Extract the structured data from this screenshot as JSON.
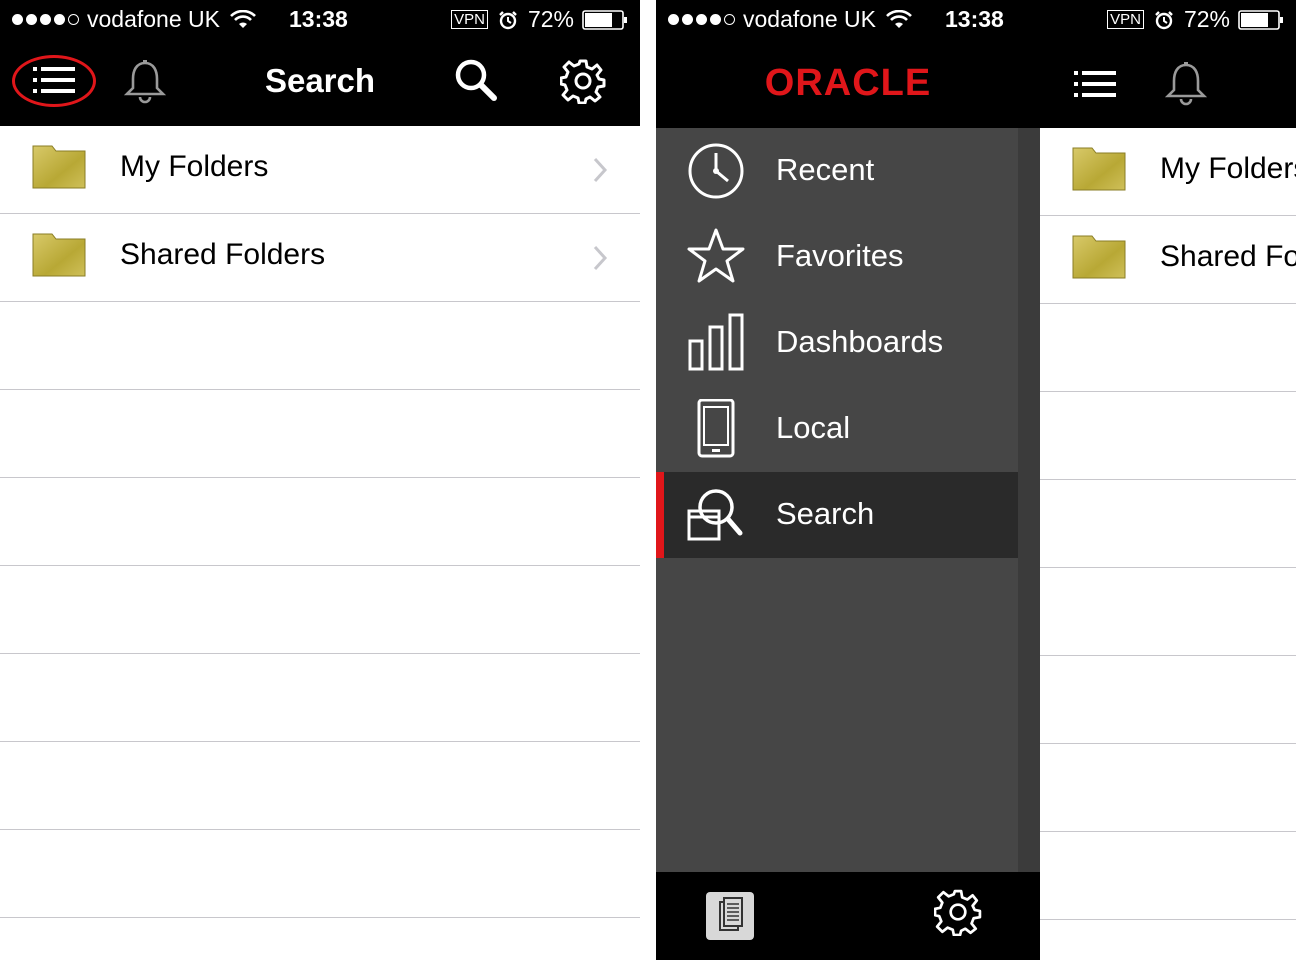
{
  "status_bar": {
    "carrier": "vodafone UK",
    "time": "13:38",
    "vpn": "VPN",
    "battery": "72%",
    "signal_bars_filled": 4,
    "signal_bars_total": 5
  },
  "left_screen": {
    "nav_title": "Search",
    "rows": [
      {
        "label": "My Folders",
        "icon": "folder-icon"
      },
      {
        "label": "Shared Folders",
        "icon": "folder-icon"
      }
    ],
    "empty_rows": 7
  },
  "right_screen": {
    "logo": "ORACLE",
    "menu": [
      {
        "label": "Recent",
        "icon": "clock-icon",
        "active": false
      },
      {
        "label": "Favorites",
        "icon": "star-icon",
        "active": false
      },
      {
        "label": "Dashboards",
        "icon": "bar-chart-icon",
        "active": false
      },
      {
        "label": "Local",
        "icon": "phone-icon",
        "active": false
      },
      {
        "label": "Search",
        "icon": "search-catalog-icon",
        "active": true
      }
    ],
    "list_rows": [
      {
        "label": "My Folders",
        "icon": "folder-icon"
      },
      {
        "label": "Shared Fo",
        "icon": "folder-icon"
      }
    ]
  },
  "colors": {
    "accent": "#e0161a",
    "bar_bg": "#000000",
    "menu_bg": "#464646",
    "menu_active_bg": "#2a2a2a",
    "folder": "#c9b94a",
    "separator": "#c8c7cc"
  }
}
